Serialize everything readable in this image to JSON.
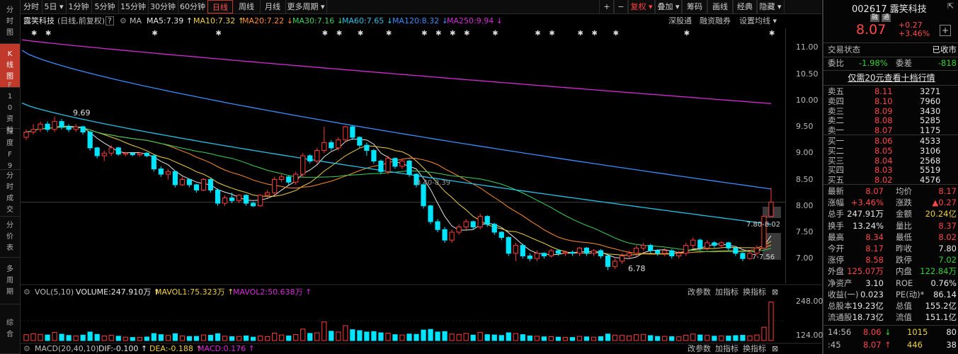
{
  "left_nav": [
    {
      "label": "分时图",
      "active": false
    },
    {
      "label": "K线图",
      "active": true
    },
    {
      "label": "F10资料",
      "active": false
    },
    {
      "label": "深度F9",
      "active": false
    },
    {
      "label": "分时成交",
      "active": false
    },
    {
      "label": "分价表",
      "active": false
    },
    {
      "label": "多周期",
      "active": false
    },
    {
      "label": "综合",
      "active": false
    }
  ],
  "toolbar": {
    "periods": [
      "分时",
      "5日 ▾",
      "1分钟",
      "5分钟",
      "15分钟",
      "30分钟",
      "60分钟",
      "日线",
      "周线",
      "月线",
      "更多周期 ▾"
    ],
    "active_period": "日线",
    "right_buttons": [
      "+",
      "−",
      "复权 ▾",
      "叠加 ▾",
      "筹码",
      "画线",
      "经典",
      "隐藏 ▾"
    ]
  },
  "chart_header": {
    "stock_name": "露笑科技",
    "mode": "(日线,前复权)",
    "help": "?",
    "ma_label": "MA",
    "ma5": "MA5:7.39 ↑",
    "ma10": "MA10:7.32 ↑",
    "ma20": "MA20:7.22 ↓",
    "ma30": "MA30:7.16 ↓",
    "ma60": "MA60:7.65 ↓",
    "ma120": "MA120:8.32 ↓",
    "ma250": "MA250:9.94 ↓",
    "tools": [
      "深股通",
      "融资融券",
      "设置均线 ▾"
    ]
  },
  "price_annotations": {
    "high_label": "9.69",
    "low_label": "6.78",
    "mid_label": "8.40-8.39",
    "right_label_1": "7.80-8.02",
    "right_label_2": "7-7.56"
  },
  "colors": {
    "up": "#ff3b3b",
    "down": "#00e5ff",
    "ma5": "#e6e6e6",
    "ma10": "#f0d040",
    "ma20": "#ff8c2a",
    "ma30": "#3ad35a",
    "ma60": "#22c3e6",
    "ma120": "#3a8cff",
    "ma250": "#d62ad6"
  },
  "volume_header": {
    "title": "VOL(5,10)",
    "volume": "VOLUME:247.910万 ↑",
    "mavol1": "MAVOL1:75.323万 ↑",
    "mavol2": "MAVOL2:50.638万 ↑",
    "tools": [
      "改参数",
      "加指标",
      "换指标",
      "⊠"
    ]
  },
  "macd_header": {
    "title": "MACD(20,40,10)",
    "dif": "DIF:-0.100 ↑",
    "dea": "DEA:-0.188 ↑",
    "macd": "MACD:0.176 ↑",
    "tools": [
      "改参数",
      "加指标",
      "换指标",
      "⊠"
    ]
  },
  "chart_data": {
    "type": "candlestick",
    "y_ticks": [
      "11.00",
      "10.50",
      "10.00",
      "9.50",
      "9.00",
      "8.50",
      "8.00",
      "7.50",
      "7.00"
    ],
    "ylim": [
      6.6,
      11.3
    ],
    "volume_ticks": [
      "248.00",
      "124.00"
    ],
    "volume_ylim": [
      0,
      260
    ],
    "candles": [
      {
        "o": 9.3,
        "c": 9.4,
        "h": 9.45,
        "l": 9.25,
        "v": 38
      },
      {
        "o": 9.4,
        "c": 9.45,
        "h": 9.55,
        "l": 9.35,
        "v": 44
      },
      {
        "o": 9.45,
        "c": 9.55,
        "h": 9.6,
        "l": 9.4,
        "v": 40
      },
      {
        "o": 9.55,
        "c": 9.45,
        "h": 9.6,
        "l": 9.4,
        "v": 36
      },
      {
        "o": 9.45,
        "c": 9.6,
        "h": 9.69,
        "l": 9.4,
        "v": 52
      },
      {
        "o": 9.6,
        "c": 9.5,
        "h": 9.65,
        "l": 9.45,
        "v": 41
      },
      {
        "o": 9.5,
        "c": 9.45,
        "h": 9.55,
        "l": 9.4,
        "v": 33
      },
      {
        "o": 9.45,
        "c": 9.5,
        "h": 9.55,
        "l": 9.4,
        "v": 30
      },
      {
        "o": 9.5,
        "c": 9.4,
        "h": 9.52,
        "l": 9.35,
        "v": 35
      },
      {
        "o": 9.4,
        "c": 9.1,
        "h": 9.42,
        "l": 9.05,
        "v": 55
      },
      {
        "o": 9.1,
        "c": 8.95,
        "h": 9.12,
        "l": 8.9,
        "v": 40
      },
      {
        "o": 8.95,
        "c": 9.0,
        "h": 9.05,
        "l": 8.85,
        "v": 30
      },
      {
        "o": 9.0,
        "c": 9.1,
        "h": 9.15,
        "l": 8.95,
        "v": 34
      },
      {
        "o": 9.1,
        "c": 8.98,
        "h": 9.12,
        "l": 8.95,
        "v": 28
      },
      {
        "o": 8.98,
        "c": 9.0,
        "h": 9.02,
        "l": 8.94,
        "v": 22
      },
      {
        "o": 9.0,
        "c": 8.97,
        "h": 9.02,
        "l": 8.94,
        "v": 20
      },
      {
        "o": 8.97,
        "c": 9.0,
        "h": 9.02,
        "l": 8.93,
        "v": 21
      },
      {
        "o": 9.0,
        "c": 8.95,
        "h": 9.02,
        "l": 8.92,
        "v": 23
      },
      {
        "o": 8.95,
        "c": 8.7,
        "h": 8.97,
        "l": 8.65,
        "v": 45
      },
      {
        "o": 8.7,
        "c": 8.6,
        "h": 8.75,
        "l": 8.55,
        "v": 38
      },
      {
        "o": 8.6,
        "c": 8.65,
        "h": 8.7,
        "l": 8.5,
        "v": 33
      },
      {
        "o": 8.65,
        "c": 8.4,
        "h": 8.67,
        "l": 8.35,
        "v": 44
      },
      {
        "o": 8.4,
        "c": 8.5,
        "h": 8.55,
        "l": 8.38,
        "v": 30
      },
      {
        "o": 8.5,
        "c": 8.4,
        "h": 8.52,
        "l": 8.35,
        "v": 26
      },
      {
        "o": 8.4,
        "c": 8.3,
        "h": 8.42,
        "l": 8.25,
        "v": 27
      },
      {
        "o": 8.3,
        "c": 8.5,
        "h": 8.52,
        "l": 8.28,
        "v": 36
      },
      {
        "o": 8.5,
        "c": 8.3,
        "h": 8.52,
        "l": 8.25,
        "v": 34
      },
      {
        "o": 8.3,
        "c": 8.05,
        "h": 8.33,
        "l": 8.0,
        "v": 44
      },
      {
        "o": 8.05,
        "c": 8.15,
        "h": 8.2,
        "l": 8.0,
        "v": 28
      },
      {
        "o": 8.15,
        "c": 8.1,
        "h": 8.25,
        "l": 8.05,
        "v": 25
      },
      {
        "o": 8.1,
        "c": 8.2,
        "h": 8.22,
        "l": 8.05,
        "v": 26
      },
      {
        "o": 8.2,
        "c": 8.05,
        "h": 8.22,
        "l": 8.0,
        "v": 30
      },
      {
        "o": 8.05,
        "c": 8.0,
        "h": 8.08,
        "l": 7.98,
        "v": 22
      },
      {
        "o": 8.0,
        "c": 8.2,
        "h": 8.22,
        "l": 7.98,
        "v": 29
      },
      {
        "o": 8.2,
        "c": 8.25,
        "h": 8.3,
        "l": 8.15,
        "v": 25
      },
      {
        "o": 8.25,
        "c": 8.5,
        "h": 8.55,
        "l": 8.2,
        "v": 48
      },
      {
        "o": 8.5,
        "c": 8.55,
        "h": 8.6,
        "l": 8.45,
        "v": 36
      },
      {
        "o": 8.55,
        "c": 8.45,
        "h": 8.58,
        "l": 8.4,
        "v": 30
      },
      {
        "o": 8.45,
        "c": 8.6,
        "h": 8.65,
        "l": 8.4,
        "v": 39
      },
      {
        "o": 8.6,
        "c": 8.95,
        "h": 9.0,
        "l": 8.55,
        "v": 74
      },
      {
        "o": 8.95,
        "c": 8.85,
        "h": 8.98,
        "l": 8.8,
        "v": 46
      },
      {
        "o": 8.85,
        "c": 9.05,
        "h": 9.1,
        "l": 8.8,
        "v": 50
      },
      {
        "o": 9.05,
        "c": 9.2,
        "h": 9.5,
        "l": 9.0,
        "v": 120
      },
      {
        "o": 9.2,
        "c": 9.1,
        "h": 9.25,
        "l": 9.05,
        "v": 60
      },
      {
        "o": 9.1,
        "c": 9.25,
        "h": 9.3,
        "l": 9.05,
        "v": 55
      },
      {
        "o": 9.25,
        "c": 9.5,
        "h": 9.52,
        "l": 9.2,
        "v": 96
      },
      {
        "o": 9.5,
        "c": 9.3,
        "h": 9.52,
        "l": 9.25,
        "v": 70
      },
      {
        "o": 9.3,
        "c": 9.15,
        "h": 9.32,
        "l": 9.1,
        "v": 64
      },
      {
        "o": 9.15,
        "c": 9.05,
        "h": 9.2,
        "l": 8.95,
        "v": 55
      },
      {
        "o": 9.05,
        "c": 8.85,
        "h": 9.08,
        "l": 8.8,
        "v": 58
      },
      {
        "o": 8.85,
        "c": 8.65,
        "h": 8.88,
        "l": 8.6,
        "v": 50
      },
      {
        "o": 8.65,
        "c": 8.9,
        "h": 8.95,
        "l": 8.6,
        "v": 48
      },
      {
        "o": 8.9,
        "c": 8.75,
        "h": 8.92,
        "l": 8.7,
        "v": 38
      },
      {
        "o": 8.75,
        "c": 8.85,
        "h": 8.9,
        "l": 8.7,
        "v": 36
      },
      {
        "o": 8.85,
        "c": 8.6,
        "h": 8.88,
        "l": 8.55,
        "v": 42
      },
      {
        "o": 8.6,
        "c": 8.4,
        "h": 8.62,
        "l": 8.35,
        "v": 40
      },
      {
        "o": 8.4,
        "c": 8.0,
        "h": 8.42,
        "l": 7.95,
        "v": 68
      },
      {
        "o": 8.0,
        "c": 7.7,
        "h": 8.02,
        "l": 7.65,
        "v": 72
      },
      {
        "o": 7.7,
        "c": 7.55,
        "h": 7.75,
        "l": 7.5,
        "v": 55
      },
      {
        "o": 7.55,
        "c": 7.35,
        "h": 7.6,
        "l": 7.3,
        "v": 58
      },
      {
        "o": 7.35,
        "c": 7.5,
        "h": 7.55,
        "l": 7.3,
        "v": 42
      },
      {
        "o": 7.5,
        "c": 7.6,
        "h": 7.65,
        "l": 7.45,
        "v": 40
      },
      {
        "o": 7.6,
        "c": 7.7,
        "h": 7.75,
        "l": 7.55,
        "v": 46
      },
      {
        "o": 7.7,
        "c": 7.6,
        "h": 7.72,
        "l": 7.55,
        "v": 35
      },
      {
        "o": 7.6,
        "c": 7.8,
        "h": 7.85,
        "l": 7.55,
        "v": 52
      },
      {
        "o": 7.8,
        "c": 7.65,
        "h": 7.82,
        "l": 7.6,
        "v": 38
      },
      {
        "o": 7.65,
        "c": 7.5,
        "h": 7.68,
        "l": 7.45,
        "v": 36
      },
      {
        "o": 7.5,
        "c": 7.4,
        "h": 7.52,
        "l": 7.35,
        "v": 33
      },
      {
        "o": 7.4,
        "c": 7.1,
        "h": 7.42,
        "l": 7.05,
        "v": 50
      },
      {
        "o": 7.1,
        "c": 7.25,
        "h": 7.3,
        "l": 6.95,
        "v": 45
      },
      {
        "o": 7.25,
        "c": 7.05,
        "h": 7.28,
        "l": 7.0,
        "v": 38
      },
      {
        "o": 7.05,
        "c": 7.0,
        "h": 7.1,
        "l": 6.95,
        "v": 30
      },
      {
        "o": 7.0,
        "c": 7.1,
        "h": 7.15,
        "l": 6.95,
        "v": 28
      },
      {
        "o": 7.1,
        "c": 7.05,
        "h": 7.12,
        "l": 7.0,
        "v": 24
      },
      {
        "o": 7.05,
        "c": 7.15,
        "h": 7.18,
        "l": 7.02,
        "v": 25
      },
      {
        "o": 7.15,
        "c": 7.1,
        "h": 7.18,
        "l": 7.05,
        "v": 22
      },
      {
        "o": 7.1,
        "c": 7.12,
        "h": 7.15,
        "l": 7.05,
        "v": 21
      },
      {
        "o": 7.12,
        "c": 7.1,
        "h": 7.15,
        "l": 7.05,
        "v": 20
      },
      {
        "o": 7.1,
        "c": 7.2,
        "h": 7.22,
        "l": 7.05,
        "v": 27
      },
      {
        "o": 7.2,
        "c": 7.1,
        "h": 7.22,
        "l": 7.05,
        "v": 24
      },
      {
        "o": 7.1,
        "c": 7.15,
        "h": 7.18,
        "l": 7.05,
        "v": 22
      },
      {
        "o": 7.15,
        "c": 7.05,
        "h": 7.18,
        "l": 7.0,
        "v": 25
      },
      {
        "o": 7.05,
        "c": 6.85,
        "h": 7.08,
        "l": 6.78,
        "v": 42
      },
      {
        "o": 6.85,
        "c": 6.95,
        "h": 7.0,
        "l": 6.8,
        "v": 35
      },
      {
        "o": 6.95,
        "c": 7.05,
        "h": 7.1,
        "l": 6.9,
        "v": 33
      },
      {
        "o": 7.05,
        "c": 7.1,
        "h": 7.15,
        "l": 7.0,
        "v": 30
      },
      {
        "o": 7.1,
        "c": 7.2,
        "h": 7.25,
        "l": 7.05,
        "v": 38
      },
      {
        "o": 7.2,
        "c": 7.25,
        "h": 7.3,
        "l": 7.15,
        "v": 40
      },
      {
        "o": 7.25,
        "c": 7.15,
        "h": 7.28,
        "l": 7.1,
        "v": 32
      },
      {
        "o": 7.15,
        "c": 7.1,
        "h": 7.18,
        "l": 7.05,
        "v": 26
      },
      {
        "o": 7.1,
        "c": 7.15,
        "h": 7.2,
        "l": 7.05,
        "v": 27
      },
      {
        "o": 7.15,
        "c": 7.05,
        "h": 7.18,
        "l": 7.0,
        "v": 25
      },
      {
        "o": 7.05,
        "c": 7.1,
        "h": 7.15,
        "l": 7.0,
        "v": 24
      },
      {
        "o": 7.1,
        "c": 7.25,
        "h": 7.3,
        "l": 7.05,
        "v": 34
      },
      {
        "o": 7.25,
        "c": 7.35,
        "h": 7.4,
        "l": 7.2,
        "v": 42
      },
      {
        "o": 7.35,
        "c": 7.2,
        "h": 7.38,
        "l": 7.15,
        "v": 36
      },
      {
        "o": 7.2,
        "c": 7.3,
        "h": 7.35,
        "l": 7.15,
        "v": 33
      },
      {
        "o": 7.3,
        "c": 7.25,
        "h": 7.33,
        "l": 7.2,
        "v": 28
      },
      {
        "o": 7.25,
        "c": 7.3,
        "h": 7.33,
        "l": 7.2,
        "v": 30
      },
      {
        "o": 7.3,
        "c": 7.2,
        "h": 7.32,
        "l": 7.15,
        "v": 29
      },
      {
        "o": 7.2,
        "c": 7.1,
        "h": 7.22,
        "l": 7.05,
        "v": 32
      },
      {
        "o": 7.1,
        "c": 7.0,
        "h": 7.12,
        "l": 6.95,
        "v": 34
      },
      {
        "o": 7.0,
        "c": 7.1,
        "h": 7.15,
        "l": 6.98,
        "v": 30
      },
      {
        "o": 7.1,
        "c": 7.2,
        "h": 7.25,
        "l": 7.05,
        "v": 36
      },
      {
        "o": 7.2,
        "c": 7.8,
        "h": 7.8,
        "l": 7.2,
        "v": 86
      },
      {
        "o": 7.8,
        "c": 8.07,
        "h": 8.34,
        "l": 8.02,
        "v": 247.9
      }
    ]
  },
  "right_panel": {
    "code_name": "002617 露笑科技",
    "tags": [
      "融",
      "通"
    ],
    "price": "8.07",
    "change": "+0.27",
    "change_pct": "+3.46%",
    "add": "+",
    "status_label": "交易状态",
    "status_value": "已收市",
    "webi_label": "委比",
    "webi_value": "-1.98%",
    "weicha_label": "委差",
    "weicha_value": "-818",
    "promo": "仅需20元查看十档行情",
    "asks": [
      {
        "label": "卖五",
        "price": "8.11",
        "vol": "3271"
      },
      {
        "label": "卖四",
        "price": "8.10",
        "vol": "7960"
      },
      {
        "label": "卖三",
        "price": "8.09",
        "vol": "3430"
      },
      {
        "label": "卖二",
        "price": "8.08",
        "vol": "5285"
      },
      {
        "label": "卖一",
        "price": "8.07",
        "vol": "1175"
      }
    ],
    "bids": [
      {
        "label": "买一",
        "price": "8.06",
        "vol": "4533"
      },
      {
        "label": "买二",
        "price": "8.05",
        "vol": "3106"
      },
      {
        "label": "买三",
        "price": "8.04",
        "vol": "2568"
      },
      {
        "label": "买四",
        "price": "8.03",
        "vol": "5519"
      },
      {
        "label": "买五",
        "price": "8.02",
        "vol": "4576"
      }
    ],
    "stats": [
      {
        "l1": "最新",
        "v1": "8.07",
        "c1": "red",
        "l2": "均价",
        "v2": "8.17",
        "c2": "red"
      },
      {
        "l1": "涨幅",
        "v1": "+3.46%",
        "c1": "red",
        "l2": "涨跌",
        "v2": "▲0.27",
        "c2": "red"
      },
      {
        "l1": "总手",
        "v1": "247.91万",
        "c1": "white",
        "l2": "金额",
        "v2": "20.24亿",
        "c2": "yellow"
      },
      {
        "l1": "换手",
        "v1": "13.24%",
        "c1": "white",
        "l2": "量比",
        "v2": "8.37",
        "c2": "red"
      },
      {
        "l1": "最高",
        "v1": "8.34",
        "c1": "red",
        "l2": "最低",
        "v2": "8.02",
        "c2": "red"
      },
      {
        "l1": "今开",
        "v1": "8.17",
        "c1": "red",
        "l2": "昨收",
        "v2": "7.80",
        "c2": "white"
      },
      {
        "l1": "涨停",
        "v1": "8.58",
        "c1": "red",
        "l2": "跌停",
        "v2": "7.02",
        "c2": "green"
      },
      {
        "l1": "外盘",
        "v1": "125.07万",
        "c1": "red",
        "l2": "内盘",
        "v2": "122.84万",
        "c2": "green"
      },
      {
        "l1": "净资产",
        "v1": "3.10",
        "c1": "white",
        "l2": "ROE",
        "v2": "0.76%",
        "c2": "white"
      },
      {
        "l1": "收益(一)",
        "v1": "0.023",
        "c1": "white",
        "l2": "PE(动)*",
        "v2": "86.14",
        "c2": "white"
      },
      {
        "l1": "总股本",
        "v1": "19.23亿",
        "c1": "white",
        "l2": "总值",
        "v2": "155.2亿",
        "c2": "white"
      },
      {
        "l1": "流通股",
        "v1": "18.73亿",
        "c1": "white",
        "l2": "流值",
        "v2": "151.1亿",
        "c2": "white"
      }
    ],
    "ticks": [
      {
        "time": "14:56",
        "price": "8.06",
        "arrow": "↓",
        "vol": "1015",
        "num": "80"
      },
      {
        "time": ":45",
        "price": "8.07",
        "arrow": "↑",
        "vol": "446",
        "num": "38"
      }
    ]
  }
}
